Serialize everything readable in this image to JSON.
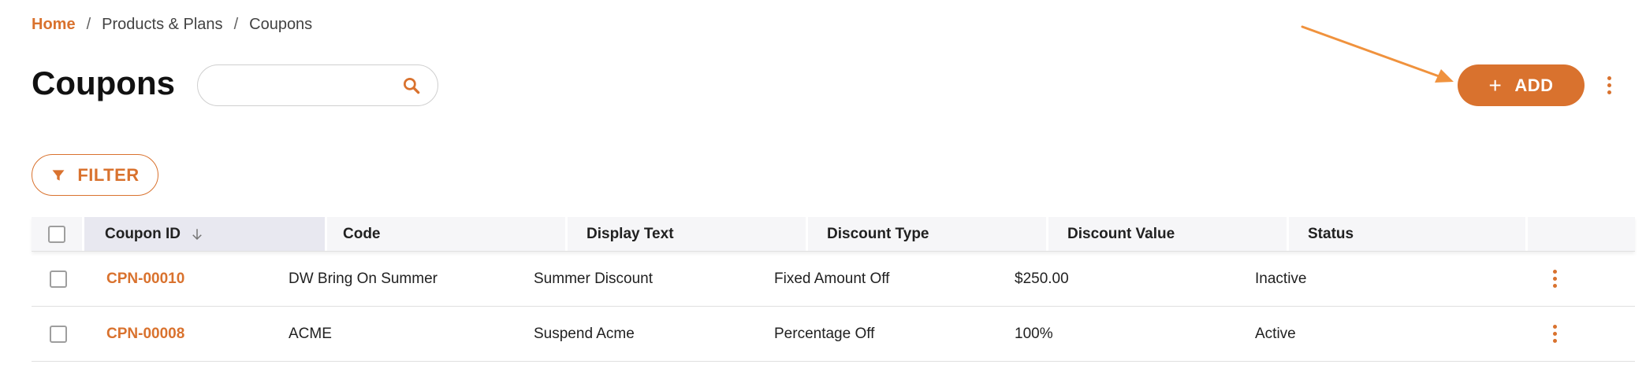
{
  "breadcrumb": {
    "home": "Home",
    "separator": "/",
    "items": [
      "Products & Plans",
      "Coupons"
    ]
  },
  "page": {
    "title": "Coupons"
  },
  "search": {
    "value": "",
    "placeholder": "",
    "icon": "search-icon"
  },
  "actions": {
    "add_plus": "+",
    "add_label": "ADD",
    "filter_label": "FILTER",
    "more_icon": "more-vert-icon"
  },
  "table": {
    "columns": [
      "Coupon ID",
      "Code",
      "Display Text",
      "Discount Type",
      "Discount Value",
      "Status"
    ],
    "sorted_column": "Coupon ID",
    "sort_direction": "descending",
    "rows": [
      {
        "id": "CPN-00010",
        "code": "DW Bring On Summer",
        "display_text": "Summer Discount",
        "discount_type": "Fixed Amount Off",
        "discount_value": "$250.00",
        "status": "Inactive"
      },
      {
        "id": "CPN-00008",
        "code": "ACME",
        "display_text": "Suspend Acme",
        "discount_type": "Percentage Off",
        "discount_value": "100%",
        "status": "Active"
      }
    ]
  },
  "colors": {
    "accent": "#d9722e",
    "header_bg": "#f6f6f8",
    "sorted_header_bg": "#e8e8f0",
    "border": "#e0e0e0"
  }
}
